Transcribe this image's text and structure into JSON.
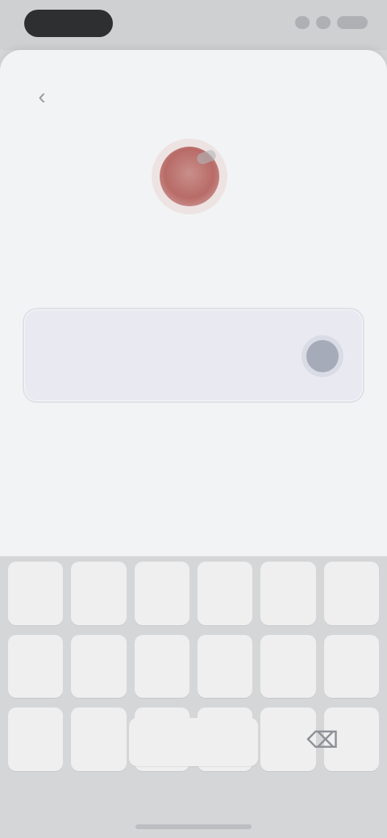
{
  "status_bar": {
    "time": ""
  },
  "sheet": {
    "back_icon": "‹",
    "title": "",
    "subtitle": "",
    "pin_value": "",
    "helper_link": ""
  },
  "keyboard": {
    "keys": [
      "",
      "",
      "",
      "",
      "",
      "",
      "",
      "",
      "",
      "",
      "",
      "",
      "",
      "",
      "",
      "",
      "",
      ""
    ],
    "delete_icon": "⌫"
  }
}
